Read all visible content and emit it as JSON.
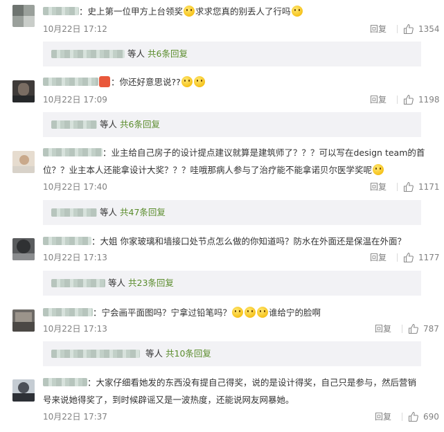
{
  "reply_label": "回复",
  "others_label": "等人",
  "comments": [
    {
      "segments": [
        "：史上第一位甲方上台领奖",
        "求求您真的别丢人了行吗"
      ],
      "time": "10月22日 17:12",
      "likes": "1354",
      "sub_count": "共6条回复"
    },
    {
      "segments": [
        "：你还好意思说??"
      ],
      "time": "10月22日 17:09",
      "likes": "1198",
      "sub_count": "共6条回复"
    },
    {
      "segments": [
        "：业主给自己房子的设计提点建议就算是建筑师了？？？可以写在design team的首",
        "位？？业主本人还能拿设计大奖？？？哇哦那病人参与了治疗能不能拿诺贝尔医学奖呢"
      ],
      "time": "10月22日 17:40",
      "likes": "1171",
      "sub_count": "共47条回复"
    },
    {
      "segments": [
        "：大姐 你家玻璃和墙接口处节点怎么做的你知道吗？防水在外面还是保温在外面？"
      ],
      "time": "10月22日 17:13",
      "likes": "1177",
      "sub_count": "共23条回复"
    },
    {
      "segments": [
        "：宁会画平面图吗？宁拿过铅笔吗？",
        "谁给宁的脸啊"
      ],
      "time": "10月22日 17:13",
      "likes": "787",
      "sub_count": "共10条回复"
    },
    {
      "segments": [
        "：大家仔细看她发的东西没有提自己得奖，说的是设计得奖，自己只是参与，然后营销",
        "号来说她得奖了，到时候辟谣又是一波热度，还能说网友网暴她。"
      ],
      "time": "10月22日 17:37",
      "likes": "690"
    }
  ]
}
